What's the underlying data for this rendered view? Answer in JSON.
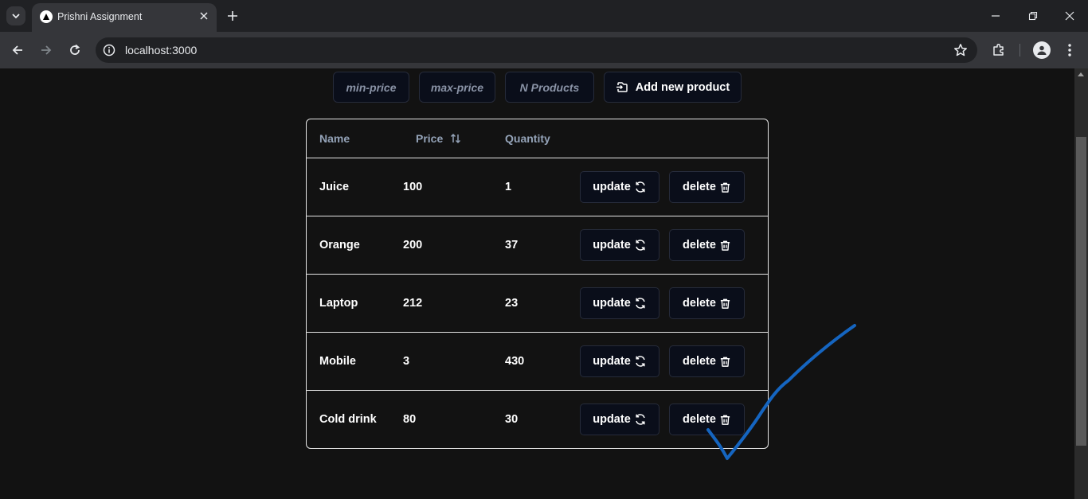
{
  "browser": {
    "tab_title": "Prishni Assignment",
    "url": "localhost:3000"
  },
  "filters": {
    "min_price_placeholder": "min-price",
    "max_price_placeholder": "max-price",
    "n_products_placeholder": "N Products",
    "add_button_label": "Add new product"
  },
  "table": {
    "headers": {
      "name": "Name",
      "price": "Price",
      "quantity": "Quantity"
    },
    "rows": [
      {
        "name": "Juice",
        "price": "100",
        "quantity": "1"
      },
      {
        "name": "Orange",
        "price": "200",
        "quantity": "37"
      },
      {
        "name": "Laptop",
        "price": "212",
        "quantity": "23"
      },
      {
        "name": "Mobile",
        "price": "3",
        "quantity": "430"
      },
      {
        "name": "Cold drink",
        "price": "80",
        "quantity": "30"
      }
    ],
    "update_label": "update",
    "delete_label": "delete"
  },
  "colors": {
    "page_bg": "#121212",
    "button_bg": "#0a0e1a",
    "annotation_stroke": "#1565c0"
  }
}
